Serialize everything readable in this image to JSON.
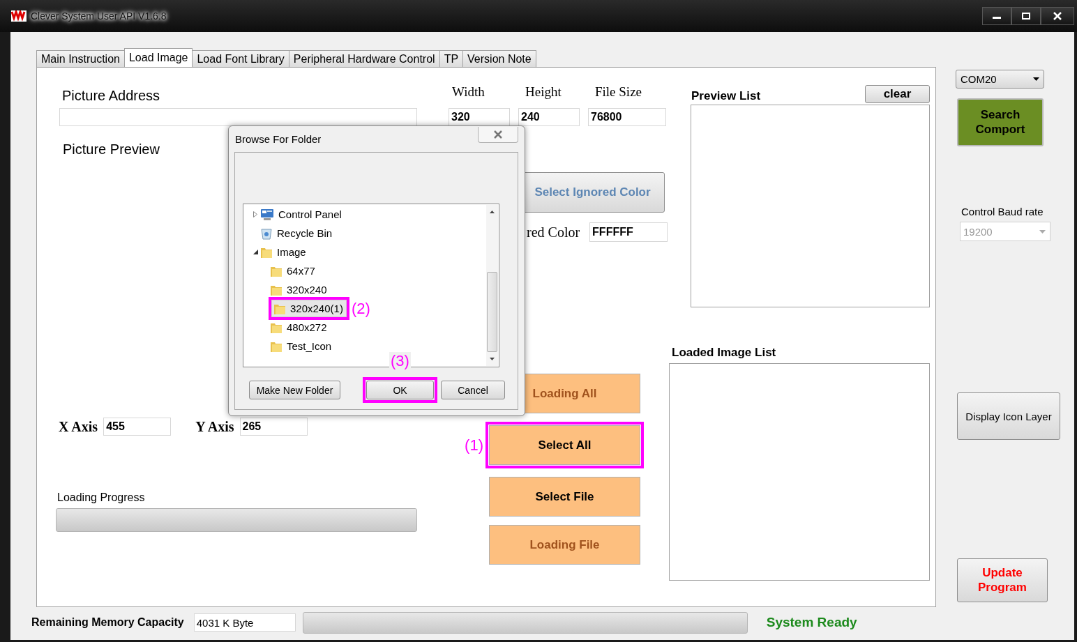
{
  "window": {
    "title": "Clever System User API V1.6.8"
  },
  "tabs": [
    {
      "label": "Main Instruction",
      "selected": false
    },
    {
      "label": "Load Image",
      "selected": true
    },
    {
      "label": "Load Font Library",
      "selected": false
    },
    {
      "label": "Peripheral Hardware Control",
      "selected": false
    },
    {
      "label": "TP",
      "selected": false
    },
    {
      "label": "Version Note",
      "selected": false
    }
  ],
  "picture_address": {
    "label": "Picture Address"
  },
  "picture_preview": {
    "label": "Picture Preview"
  },
  "image_info": [
    {
      "label": "Width",
      "value": "320"
    },
    {
      "label": "Height",
      "value": "240"
    },
    {
      "label": "File Size",
      "value": "76800"
    }
  ],
  "select_ignored_color_button": {
    "label": "Select Ignored Color"
  },
  "ignored_color": {
    "label": "red Color",
    "value": "FFFFFF"
  },
  "axes": [
    {
      "label": "X Axis",
      "value": "455"
    },
    {
      "label": "Y Axis",
      "value": "265"
    }
  ],
  "loading_progress": {
    "label": "Loading Progress",
    "level": 0
  },
  "action_buttons": [
    {
      "label": "Loading All",
      "disabled": true
    },
    {
      "label": "Select All",
      "disabled": false,
      "annotation": "(1)"
    },
    {
      "label": "Select File",
      "disabled": false
    },
    {
      "label": "Loading File",
      "disabled": true
    }
  ],
  "preview_list": {
    "label": "Preview List",
    "clear_button": "clear"
  },
  "loaded_image_list": {
    "label": "Loaded Image List"
  },
  "sidebar": {
    "port": "COM20",
    "search_button": "Search Comport",
    "baud_label": "Control Baud rate",
    "baud_rate": "19200",
    "display_icon_layer_button": "Display Icon Layer",
    "update_button": "Update Program"
  },
  "status_bar": {
    "memory_label": "Remaining Memory Capacity",
    "memory_value": "4031 K Byte",
    "level": 0,
    "status": "System Ready"
  },
  "dialog": {
    "title": "Browse For Folder",
    "tree": [
      {
        "label": "Control Panel",
        "kind": "control-panel",
        "expanded": false,
        "selected": false
      },
      {
        "label": "Recycle Bin",
        "kind": "recycle-bin",
        "selected": false
      },
      {
        "label": "Image",
        "kind": "folder",
        "expanded": true,
        "selected": false,
        "children": [
          {
            "label": "64x77",
            "kind": "folder",
            "selected": false
          },
          {
            "label": "320x240",
            "kind": "folder",
            "selected": false
          },
          {
            "label": "320x240(1)",
            "kind": "folder",
            "selected": true,
            "annotation": "(2)"
          },
          {
            "label": "480x272",
            "kind": "folder",
            "selected": false
          },
          {
            "label": "Test_Icon",
            "kind": "folder",
            "selected": false
          }
        ]
      }
    ],
    "buttons": [
      {
        "label": "Make New Folder"
      },
      {
        "label": "OK",
        "annotation": "(3)"
      },
      {
        "label": "Cancel"
      }
    ]
  }
}
